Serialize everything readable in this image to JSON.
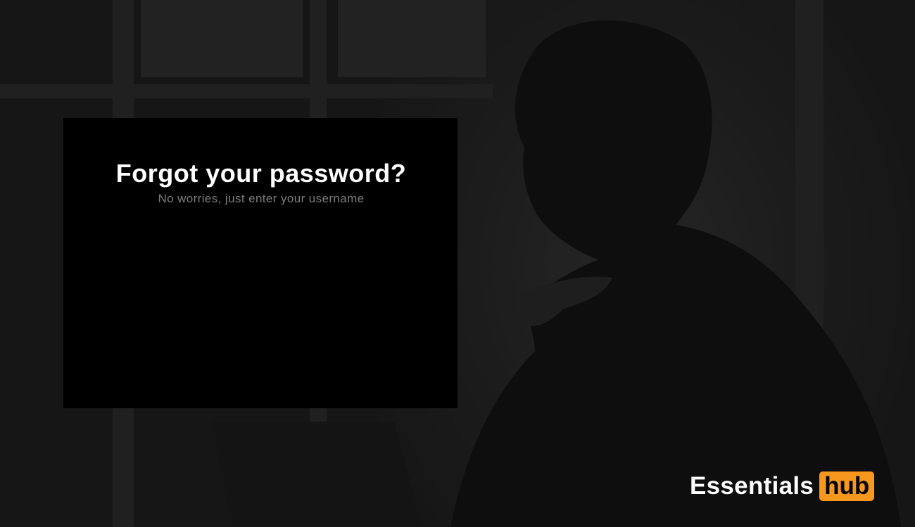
{
  "forgot_password": {
    "title": "Forgot your password?",
    "subtitle": "No worries, just enter your username"
  },
  "brand": {
    "name": "Essentials",
    "badge": "hub",
    "badge_color": "#f7971d"
  },
  "background": {
    "description_icon": "man-with-laptop-photo"
  }
}
